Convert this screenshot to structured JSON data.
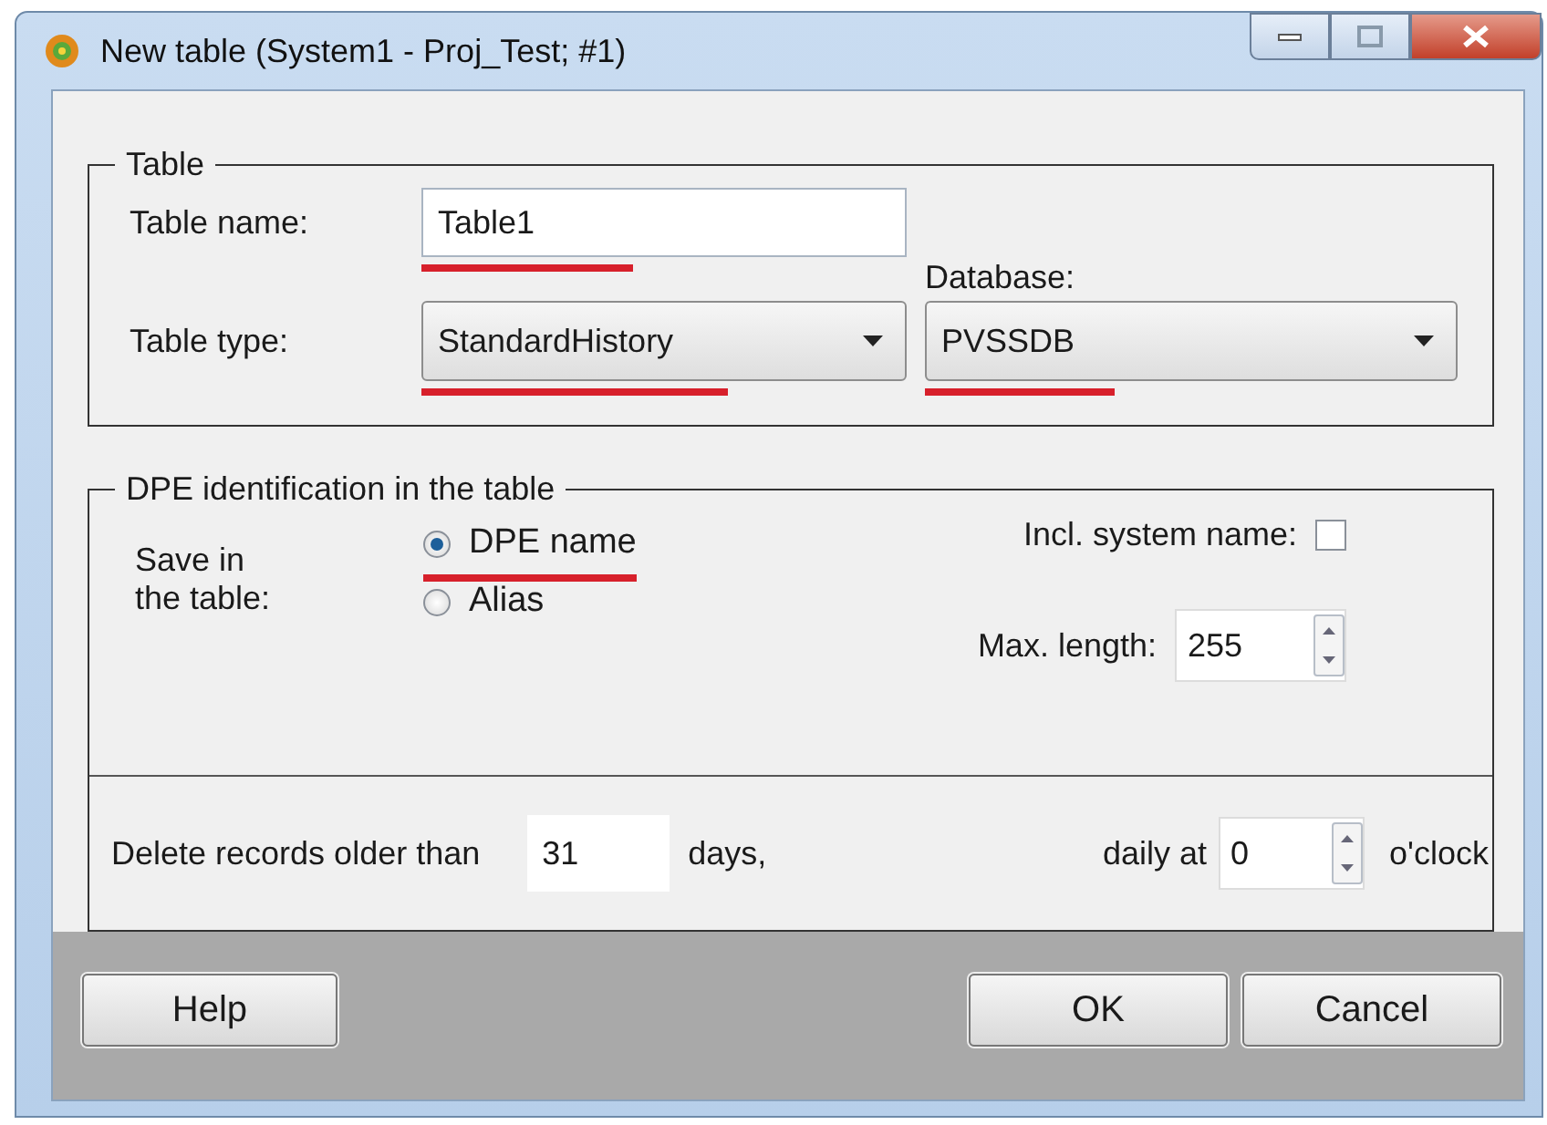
{
  "window": {
    "title": "New table (System1 - Proj_Test; #1)"
  },
  "table_group": {
    "title": "Table",
    "table_name": {
      "label": "Table name:",
      "value": "Table1",
      "underlined": true
    },
    "table_type": {
      "label": "Table type:",
      "value": "StandardHistory",
      "underlined": true
    },
    "database": {
      "label": "Database:",
      "value": "PVSSDB",
      "underlined": true
    }
  },
  "dpe_group": {
    "title": "DPE identification in the table",
    "save_label": "Save in\nthe table:",
    "options": [
      {
        "label": "DPE name",
        "selected": true,
        "underlined": true
      },
      {
        "label": "Alias",
        "selected": false,
        "underlined": false
      }
    ],
    "include_system_name": {
      "label": "Incl. system name:",
      "checked": false
    },
    "max_length": {
      "label": "Max. length:",
      "value": "255"
    },
    "delete_label": "Delete records older than",
    "days_value": "31",
    "days_label": "days,",
    "daily_label": "daily at",
    "hour_value": "0",
    "oclock_label": "o'clock"
  },
  "buttons": [
    {
      "label": "Help"
    },
    {
      "label": "OK"
    },
    {
      "label": "Cancel"
    }
  ]
}
